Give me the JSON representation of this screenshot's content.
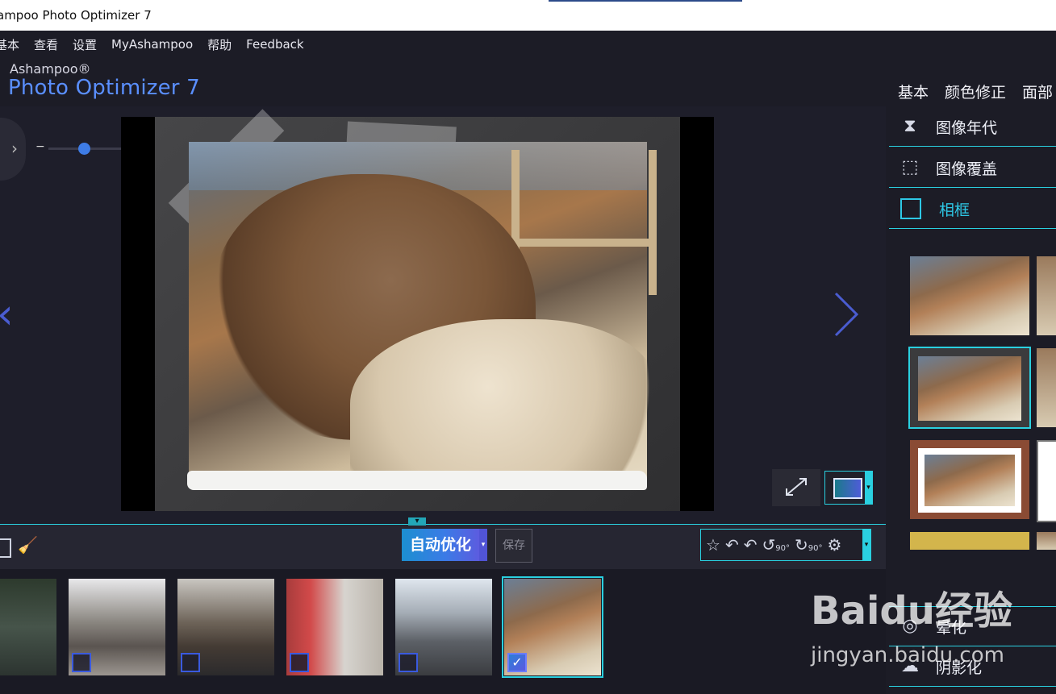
{
  "window": {
    "title": "ampoo Photo Optimizer 7"
  },
  "menu": {
    "items": [
      "基本",
      "查看",
      "设置",
      "MyAshampoo",
      "帮助",
      "Feedback"
    ]
  },
  "brand": {
    "company": "Ashampoo®",
    "product": "Photo Optimizer 7"
  },
  "topnav": {
    "items": [
      "基本",
      "颜色修正",
      "面部"
    ]
  },
  "zoom": {
    "minus": "−",
    "plus": "+",
    "level": 0.4
  },
  "toolbar": {
    "auto_optimize": "自动优化",
    "save": "保存",
    "rotate_left_label": "90°",
    "rotate_right_label": "90°"
  },
  "filmstrip": {
    "thumbs": [
      {
        "name": "forest",
        "checked": false
      },
      {
        "name": "station-roof",
        "checked": false
      },
      {
        "name": "street-bikes",
        "checked": false
      },
      {
        "name": "red-train",
        "checked": false
      },
      {
        "name": "platform",
        "checked": false
      },
      {
        "name": "cow",
        "checked": true
      }
    ],
    "check_glyph": "✓"
  },
  "right_panel": {
    "items": [
      {
        "label": "图像年代",
        "icon": "hourglass-icon"
      },
      {
        "label": "图像覆盖",
        "icon": "overlay-icon"
      },
      {
        "label": "相框",
        "icon": "frame-icon",
        "active": true
      },
      {
        "label": "晕化",
        "icon": "vignette-icon"
      },
      {
        "label": "阴影化",
        "icon": "shadow-icon"
      }
    ]
  },
  "watermark": {
    "logo": "Baidu经验",
    "url": "jingyan.baidu.com"
  },
  "colors": {
    "accent": "#2ad0e0",
    "brand_blue": "#5a8fff",
    "bg": "#1e1e2a"
  }
}
